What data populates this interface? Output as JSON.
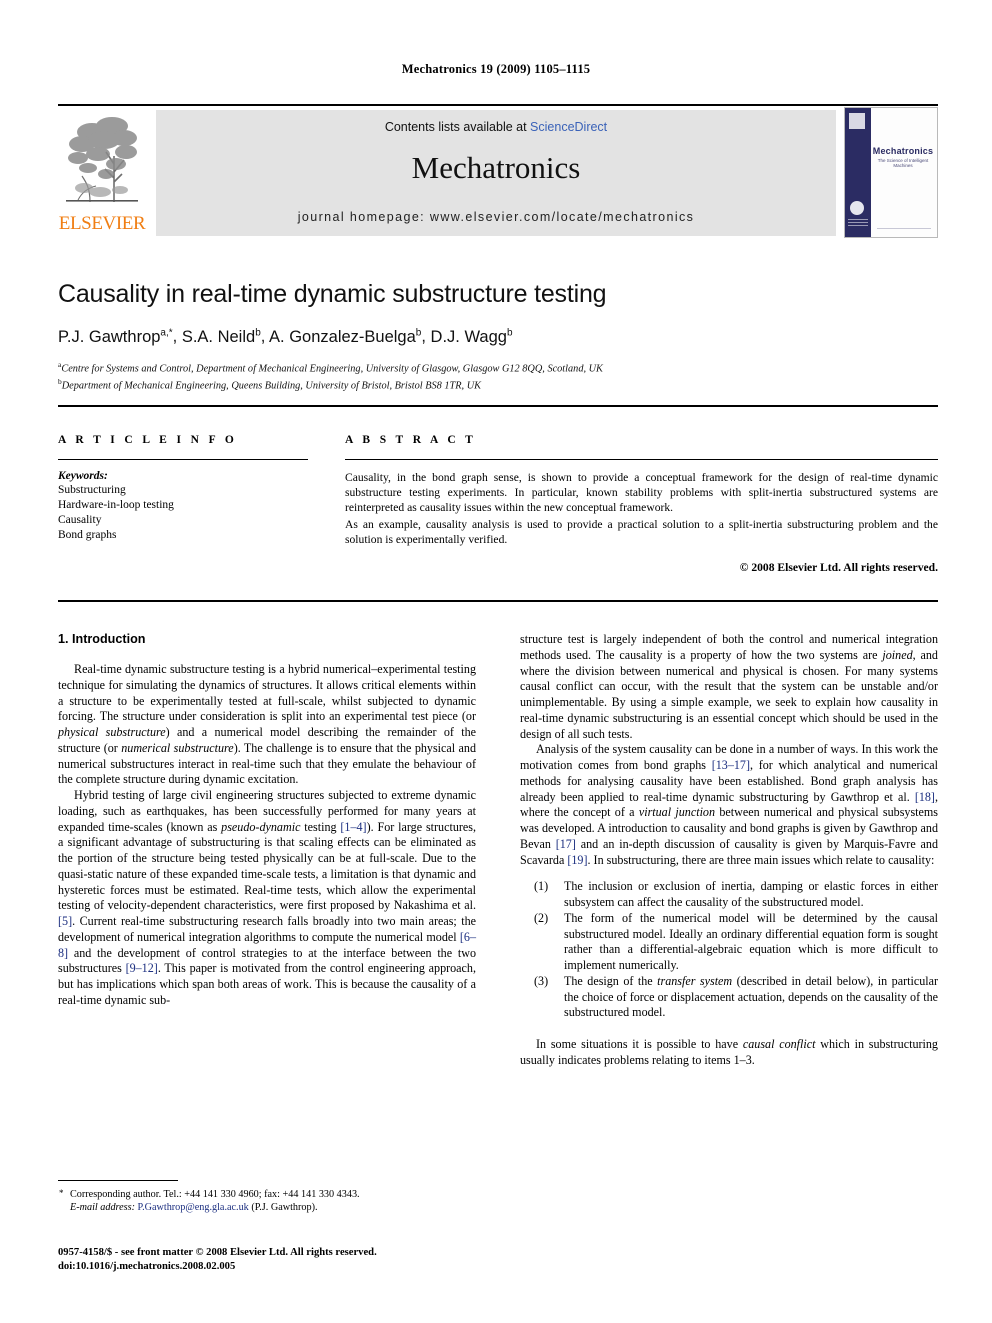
{
  "running_head": "Mechatronics 19 (2009) 1105–1115",
  "masthead": {
    "publisher_name": "ELSEVIER",
    "contents_prefix": "Contents lists available at ",
    "contents_link": "ScienceDirect",
    "journal_name": "Mechatronics",
    "homepage": "journal homepage: www.elsevier.com/locate/mechatronics",
    "cover": {
      "title": "Mechatronics",
      "subtitle": "The Science of Intelligent Machines"
    }
  },
  "title": "Causality in real-time dynamic substructure testing",
  "authors": [
    {
      "name": "P.J. Gawthrop",
      "sup": "a,*"
    },
    {
      "name": "S.A. Neild",
      "sup": "b"
    },
    {
      "name": "A. Gonzalez-Buelga",
      "sup": "b"
    },
    {
      "name": "D.J. Wagg",
      "sup": "b"
    }
  ],
  "affiliations": [
    {
      "label": "a",
      "text": "Centre for Systems and Control, Department of Mechanical Engineering, University of Glasgow, Glasgow G12 8QQ, Scotland, UK"
    },
    {
      "label": "b",
      "text": "Department of Mechanical Engineering, Queens Building, University of Bristol, Bristol BS8 1TR, UK"
    }
  ],
  "article_info": {
    "heading": "A R T I C L E   I N F O",
    "keywords_heading": "Keywords:",
    "keywords": [
      "Substructuring",
      "Hardware-in-loop testing",
      "Causality",
      "Bond graphs"
    ]
  },
  "abstract": {
    "heading": "A B S T R A C T",
    "paragraphs": [
      "Causality, in the bond graph sense, is shown to provide a conceptual framework for the design of real-time dynamic substructure testing experiments. In particular, known stability problems with split-inertia substructured systems are reinterpreted as causality issues within the new conceptual framework.",
      "As an example, causality analysis is used to provide a practical solution to a split-inertia substructuring problem and the solution is experimentally verified."
    ],
    "copyright": "© 2008 Elsevier Ltd. All rights reserved."
  },
  "section_heading": "1. Introduction",
  "body": {
    "left": [
      "Real-time dynamic substructure testing is a hybrid numerical–experimental testing technique for simulating the dynamics of structures. It allows critical elements within a structure to be experimentally tested at full-scale, whilst subjected to dynamic forcing. The structure under consideration is split into an experimental test piece (or ",
      "physical substructure",
      ") and a numerical model describing the remainder of the structure (or ",
      "numerical substructure",
      "). The challenge is to ensure that the physical and numerical substructures interact in real-time such that they emulate the behaviour of the complete structure during dynamic excitation."
    ],
    "left_p2_parts": [
      "Hybrid testing of large civil engineering structures subjected to extreme dynamic loading, such as earthquakes, has been successfully performed for many years at expanded time-scales (known as ",
      "pseudo-dynamic",
      " testing ",
      "[1–4]",
      "). For large structures, a significant advantage of substructuring is that scaling effects can be eliminated as the portion of the structure being tested physically can be at full-scale. Due to the quasi-static nature of these expanded time-scale tests, a limitation is that dynamic and hysteretic forces must be estimated. Real-time tests, which allow the experimental testing of velocity-dependent characteristics, were first proposed by Nakashima et al. ",
      "[5]",
      ". Current real-time substructuring research falls broadly into two main areas; the development of numerical integration algorithms to compute the numerical model ",
      "[6–8]",
      " and the development of control strategies to at the interface between the two substructures ",
      "[9–12]",
      ". This paper is motivated from the control engineering approach, but has implications which span both areas of work. This is because the causality of a real-time dynamic sub-"
    ],
    "right_p1_parts": [
      "structure test is largely independent of both the control and numerical integration methods used. The causality is a property of how the two systems are ",
      "joined",
      ", and where the division between numerical and physical is chosen. For many systems causal conflict can occur, with the result that the system can be unstable and/or unimplementable. By using a simple example, we seek to explain how causality in real-time dynamic substructuring is an essential concept which should be used in the design of all such tests."
    ],
    "right_p2_parts": [
      "Analysis of the system causality can be done in a number of ways. In this work the motivation comes from bond graphs ",
      "[13–17]",
      ", for which analytical and numerical methods for analysing causality have been established. Bond graph analysis has already been applied to real-time dynamic substructuring by Gawthrop et al. ",
      "[18]",
      ", where the concept of a ",
      "virtual junction",
      " between numerical and physical subsystems was developed. A introduction to causality and bond graphs is given by Gawthrop and Bevan ",
      "[17]",
      " and an in-depth discussion of causality is given by Marquis-Favre and Scavarda ",
      "[19]",
      ". In substructuring, there are three main issues which relate to causality:"
    ],
    "issues": [
      {
        "marker": "(1)",
        "parts": [
          "The inclusion or exclusion of inertia, damping or elastic forces in either subsystem can affect the causality of the substructured model."
        ]
      },
      {
        "marker": "(2)",
        "parts": [
          "The form of the numerical model will be determined by the causal substructured model. Ideally an ordinary differential equation form is sought rather than a differential-algebraic equation which is more difficult to implement numerically."
        ]
      },
      {
        "marker": "(3)",
        "parts": [
          "The design of the ",
          "transfer system",
          " (described in detail below), in particular the choice of force or displacement actuation, depends on the causality of the substructured model."
        ]
      }
    ],
    "right_p3_parts": [
      "In some situations it is possible to have ",
      "causal conflict",
      " which in substructuring usually indicates problems relating to items 1–3."
    ]
  },
  "footnotes": {
    "corresponding": "Corresponding author. Tel.: +44 141 330 4960; fax: +44 141 330 4343.",
    "email_label": "E-mail address:",
    "email": "P.Gawthrop@eng.gla.ac.uk",
    "email_owner": "(P.J. Gawthrop)."
  },
  "issn_line": "0957-4158/$ - see front matter © 2008 Elsevier Ltd. All rights reserved.",
  "doi_line": "doi:10.1016/j.mechatronics.2008.02.005",
  "colors": {
    "citation_blue": "#1c2f80",
    "link_blue": "#3a62b8",
    "elsevier_orange": "#F07E13",
    "cover_navy": "#2b2c63",
    "band_grey": "#e3e3e3"
  }
}
